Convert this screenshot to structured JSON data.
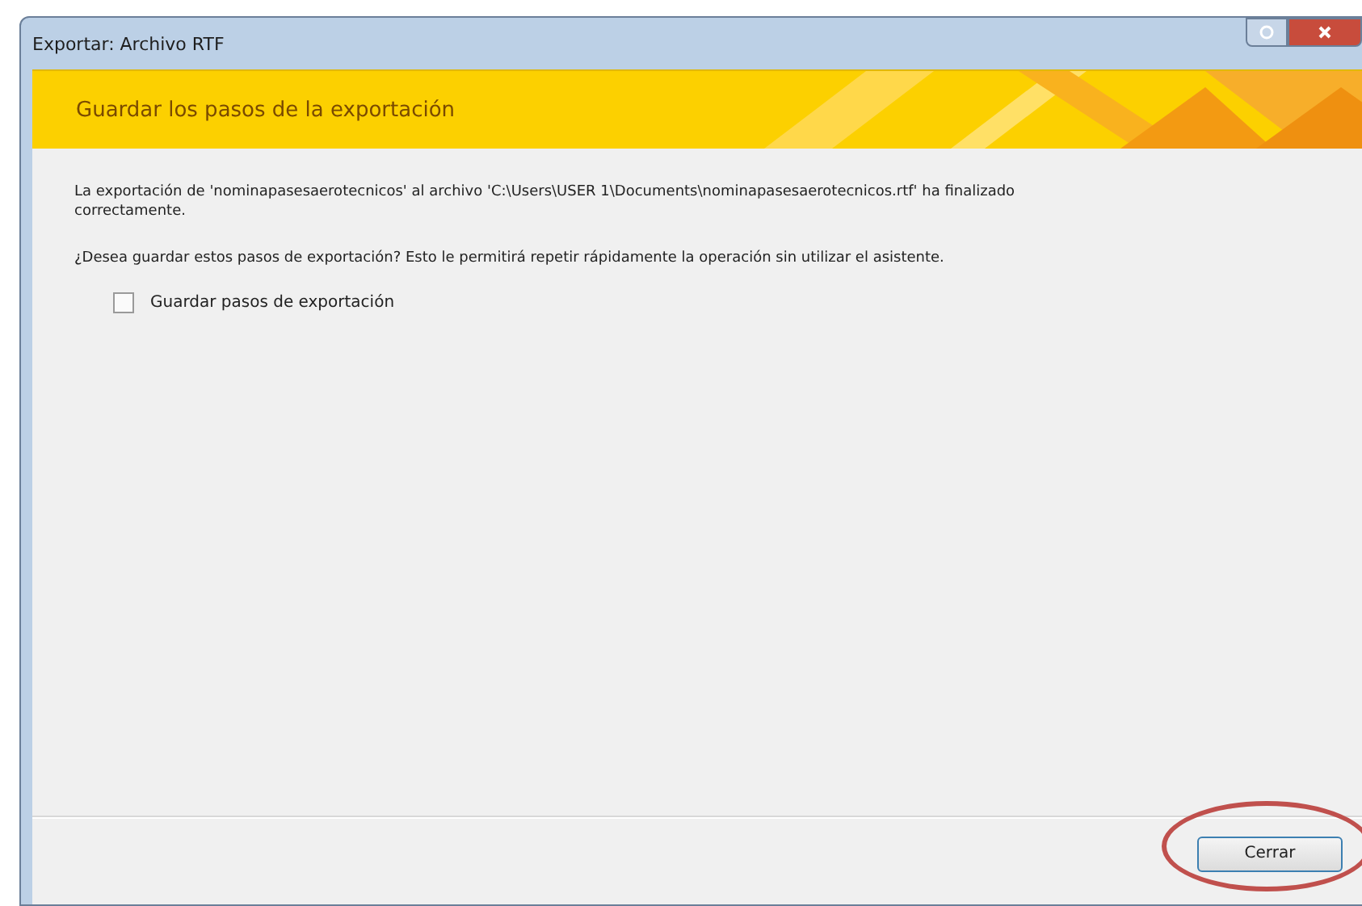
{
  "window": {
    "title": "Exportar: Archivo RTF"
  },
  "banner": {
    "title": "Guardar los pasos de la exportación"
  },
  "message": "La exportación de 'nominapasesaerotecnicos' al archivo 'C:\\Users\\USER 1\\Documents\\nominapasesaerotecnicos.rtf' ha finalizado correctamente.",
  "question": "¿Desea guardar estos pasos de exportación? Esto le permitirá repetir rápidamente la operación sin utilizar el asistente.",
  "save_steps": {
    "label": "Guardar pasos de exportación",
    "checked": false
  },
  "buttons": [
    {
      "label": "Cerrar",
      "circled": true
    }
  ]
}
